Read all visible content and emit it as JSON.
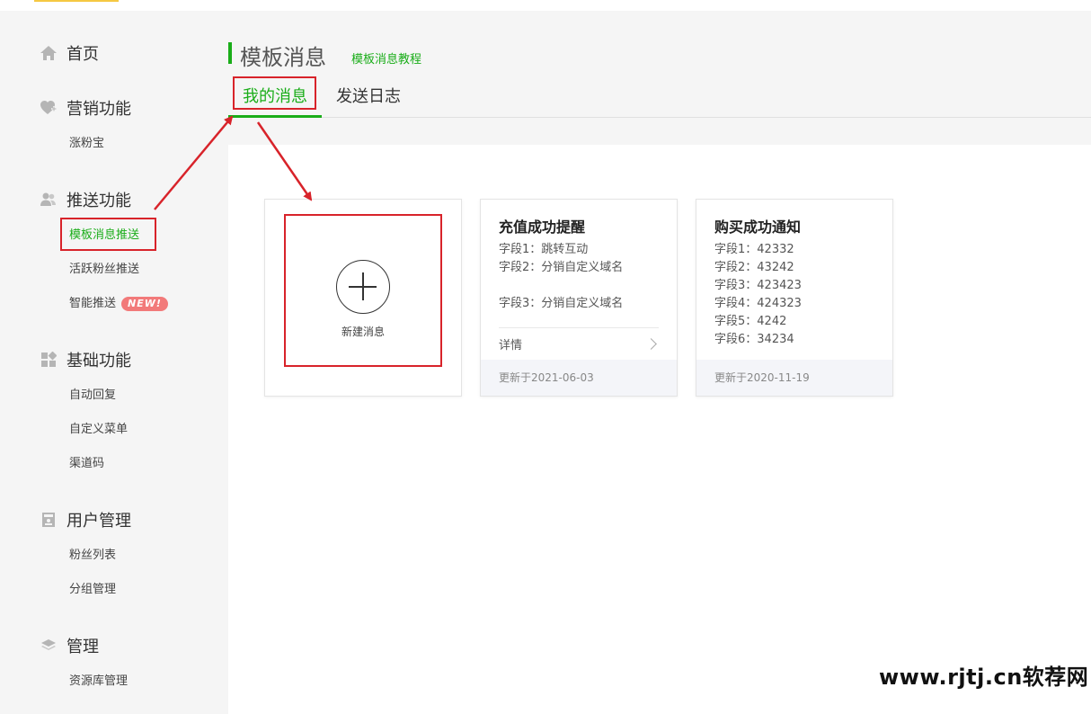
{
  "sidebar": {
    "groups": [
      {
        "label": "首页",
        "icon": "home-icon"
      },
      {
        "label": "营销功能",
        "icon": "heart-plus-icon",
        "items": [
          "涨粉宝"
        ]
      },
      {
        "label": "推送功能",
        "icon": "users-icon",
        "items": [
          "模板消息推送",
          "活跃粉丝推送",
          "智能推送"
        ]
      },
      {
        "label": "基础功能",
        "icon": "grid-icon",
        "items": [
          "自动回复",
          "自定义菜单",
          "渠道码"
        ]
      },
      {
        "label": "用户管理",
        "icon": "user-card-icon",
        "items": [
          "粉丝列表",
          "分组管理"
        ]
      },
      {
        "label": "管理",
        "icon": "layers-icon",
        "items": [
          "资源库管理"
        ]
      }
    ],
    "new_badge": "NEW!"
  },
  "header": {
    "title": "模板消息",
    "tutorial_link": "模板消息教程"
  },
  "tabs": [
    {
      "label": "我的消息",
      "active": true
    },
    {
      "label": "发送日志",
      "active": false
    }
  ],
  "new_card": {
    "label": "新建消息"
  },
  "cards": [
    {
      "title": "充值成功提醒",
      "fields": [
        "字段1：跳转互动",
        "字段2：分销自定义域名",
        "",
        "字段3：分销自定义域名"
      ],
      "detail": "详情",
      "updated": "更新于2021-06-03"
    },
    {
      "title": "购买成功通知",
      "fields": [
        "字段1：42332",
        "字段2：43242",
        "字段3：423423",
        "字段4：424323",
        "字段5：4242",
        "字段6：34234"
      ],
      "updated": "更新于2020-11-19"
    }
  ],
  "watermark": "www.rjtj.cn软荐网",
  "colors": {
    "accent": "#1aad19",
    "annotation": "#d8232a",
    "badge": "#f27a7a"
  }
}
